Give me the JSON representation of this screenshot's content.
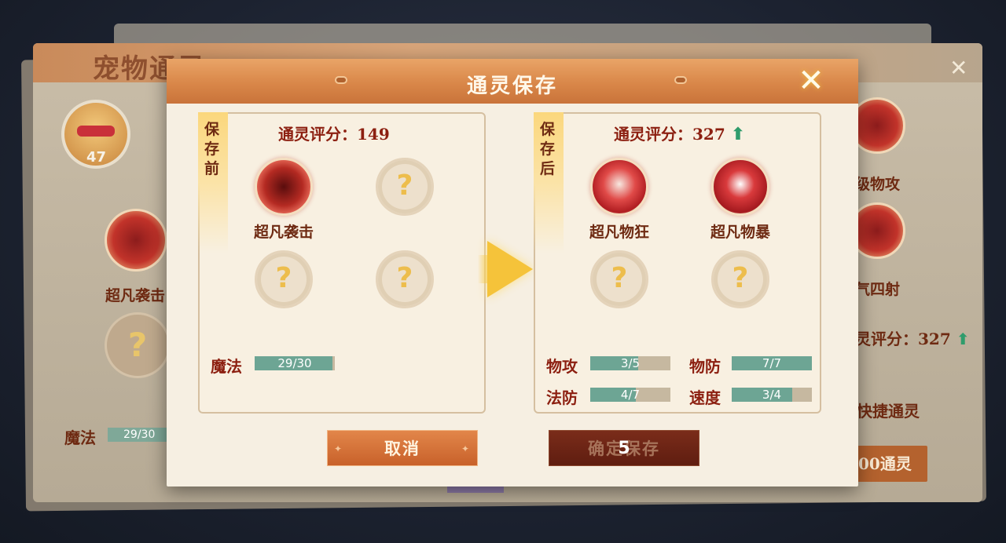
{
  "background": {
    "title": "宠物通灵",
    "close_icon": "close-icon",
    "pet_level": "47",
    "left_skill_label": "超凡袭击",
    "left_empty_slot": "?",
    "magic_label": "魔法",
    "magic_value": "29/30",
    "right_skill_labels": [
      "级物攻",
      "气四射"
    ],
    "score_label": "灵评分：327",
    "score_up": "⬆",
    "quick_label": "快捷通灵",
    "action_label": "00通灵"
  },
  "dialog": {
    "title": "通灵保存",
    "close_glyph": "✕",
    "before": {
      "tag": "保存前",
      "score_label": "通灵评分：149",
      "slots": [
        {
          "type": "skill",
          "label": "超凡袭击",
          "icon": "claw-strike-icon"
        },
        {
          "type": "empty",
          "label": "?"
        },
        {
          "type": "empty",
          "label": "?"
        },
        {
          "type": "empty",
          "label": "?"
        }
      ],
      "stats": [
        {
          "name": "魔法",
          "value": "29/30",
          "fraction": 0.967
        }
      ]
    },
    "after": {
      "tag": "保存后",
      "score_label": "通灵评分：327",
      "score_up": "⬆",
      "slots": [
        {
          "type": "skill",
          "label": "超凡物狂",
          "icon": "blade-frenzy-icon"
        },
        {
          "type": "skill",
          "label": "超凡物暴",
          "icon": "sword-crit-icon"
        },
        {
          "type": "empty",
          "label": "?"
        },
        {
          "type": "empty",
          "label": "?"
        }
      ],
      "stats": [
        {
          "name": "物攻",
          "value": "3/5",
          "fraction": 0.6
        },
        {
          "name": "物防",
          "value": "7/7",
          "fraction": 1.0
        },
        {
          "name": "法防",
          "value": "4/7",
          "fraction": 0.571
        },
        {
          "name": "速度",
          "value": "3/4",
          "fraction": 0.75
        }
      ]
    },
    "cancel_label": "取消",
    "confirm_label": "确定保存",
    "confirm_countdown": "5",
    "accent": "#d98749",
    "stat_bar_color": "#6da594",
    "score_up_color": "#2f9c6c"
  }
}
